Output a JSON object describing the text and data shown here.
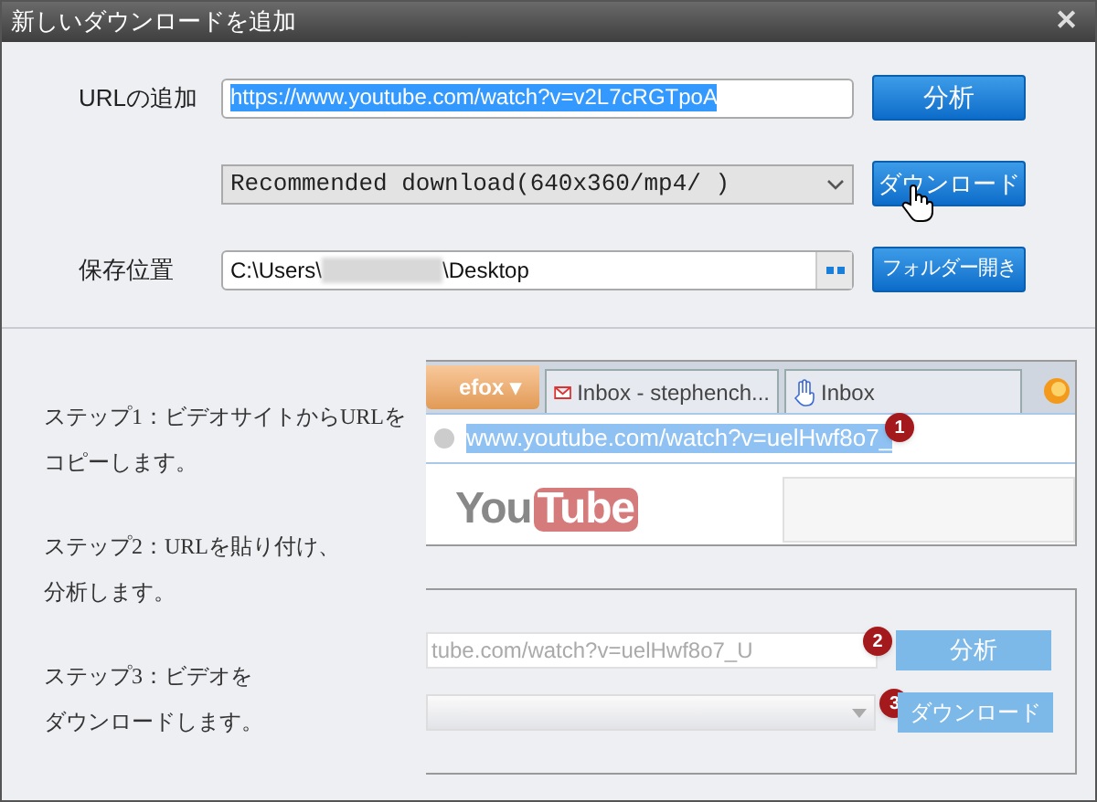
{
  "window": {
    "title": "新しいダウンロードを追加",
    "close": "✕"
  },
  "url_row": {
    "label": "URLの追加",
    "value": "https://www.youtube.com/watch?v=v2L7cRGTpoA",
    "button": "分析"
  },
  "format_row": {
    "value": "Recommended download(640x360/mp4/ )",
    "button": "ダウンロード"
  },
  "save_row": {
    "label": "保存位置",
    "path_start": "C:\\Users\\",
    "path_end": "\\Desktop",
    "button": "フォルダー開き"
  },
  "steps": [
    {
      "lines": [
        "ステップ1：ビデオサイトからURLを",
        "コピーします。"
      ]
    },
    {
      "lines": [
        "ステップ2：URLを貼り付け、",
        "分析します。"
      ]
    },
    {
      "lines": [
        "ステップ3：ビデオを",
        "ダウンロードします。"
      ]
    }
  ],
  "browser_example": {
    "tabs": [
      {
        "label": "efox ▾",
        "kind": "menu"
      },
      {
        "label": "Inbox - stephench...",
        "kind": "mail"
      },
      {
        "label": "Inbox",
        "kind": "hand"
      }
    ],
    "address": "www.youtube.com/watch?v=uelHwf8o7_",
    "badge": "1",
    "logo_start": "You",
    "logo_end": "Tube"
  },
  "app_example": {
    "field": "tube.com/watch?v=uelHwf8o7_U",
    "analyze_badge": "2",
    "analyze_button": "分析",
    "download_badge": "3",
    "download_button": "ダウンロード"
  }
}
